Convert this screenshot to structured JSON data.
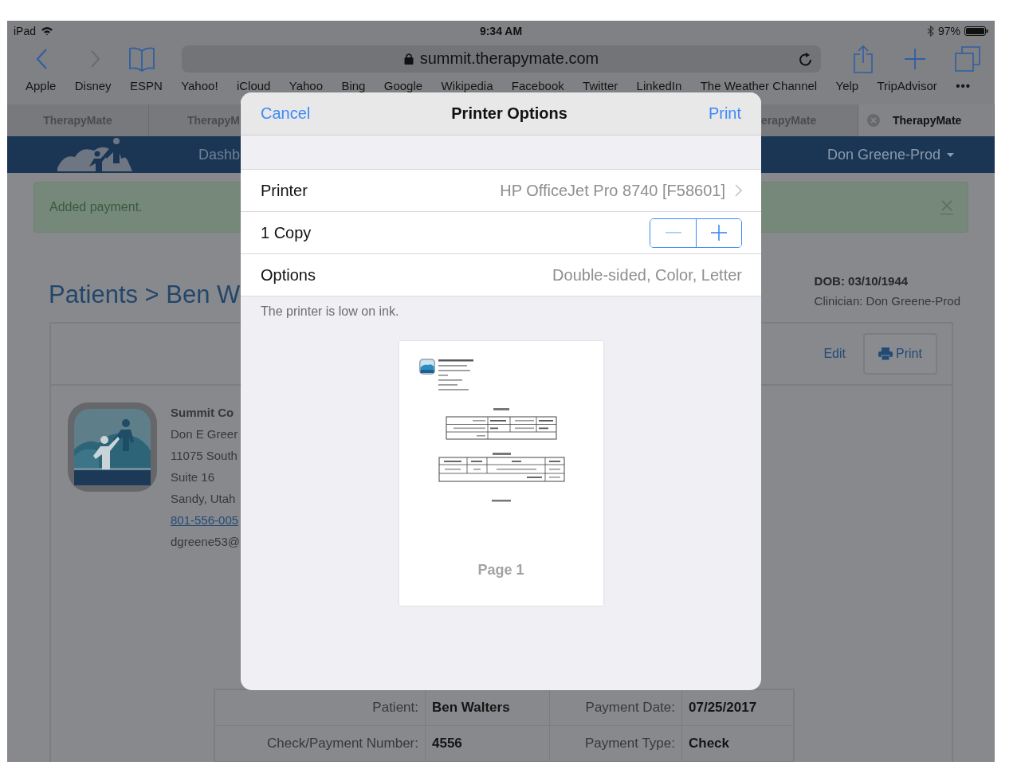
{
  "status_bar": {
    "device": "iPad",
    "time": "9:34 AM",
    "battery": "97%"
  },
  "browser": {
    "url": "summit.therapymate.com",
    "bookmarks": [
      "Apple",
      "Disney",
      "ESPN",
      "Yahoo!",
      "iCloud",
      "Yahoo",
      "Bing",
      "Google",
      "Wikipedia",
      "Facebook",
      "Twitter",
      "LinkedIn",
      "The Weather Channel",
      "Yelp",
      "TripAdvisor"
    ],
    "more": "•••",
    "tabs": [
      {
        "label": "TherapyMate",
        "selected": false,
        "kind": "whole"
      },
      {
        "label": "TherapyM",
        "selected": false,
        "kind": "cut_right"
      },
      {
        "label": "erapyMate",
        "selected": false,
        "kind": "cut_left"
      },
      {
        "label": "TherapyMate",
        "selected": true,
        "kind": "whole"
      }
    ]
  },
  "nav": {
    "item": "Dashb",
    "user": "Don Greene-Prod"
  },
  "alert": {
    "message": "Added payment."
  },
  "page": {
    "title": "Patients > Ben W",
    "dob": "DOB: 03/10/1944",
    "clinician": "Clinician: Don Greene-Prod",
    "edit": "Edit",
    "print": "Print",
    "company": "Summit Co",
    "address": [
      {
        "text": "Don E Greer",
        "link": false
      },
      {
        "text": "11075 South",
        "link": false
      },
      {
        "text": "Suite 16",
        "link": false
      },
      {
        "text": "Sandy, Utah",
        "link": false
      },
      {
        "text": "801-556-005",
        "link": true
      },
      {
        "text": "dgreene53@",
        "link": false
      }
    ],
    "receipt": [
      [
        {
          "label": "Patient:",
          "value": "Ben Walters"
        },
        {
          "label": "Payment Date:",
          "value": "07/25/2017"
        }
      ],
      [
        {
          "label": "Check/Payment Number:",
          "value": "4556"
        },
        {
          "label": "Payment Type:",
          "value": "Check"
        }
      ]
    ]
  },
  "modal": {
    "cancel": "Cancel",
    "title": "Printer Options",
    "print": "Print",
    "rows": [
      {
        "kind": "link",
        "label": "Printer",
        "value": "HP OfficeJet Pro 8740 [F58601]"
      },
      {
        "kind": "stepper",
        "label": "1 Copy",
        "decrement_disabled": true
      },
      {
        "kind": "value",
        "label": "Options",
        "value": "Double-sided, Color, Letter"
      }
    ],
    "note": "The printer is low on ink.",
    "preview": {
      "page_label": "Page 1"
    }
  }
}
